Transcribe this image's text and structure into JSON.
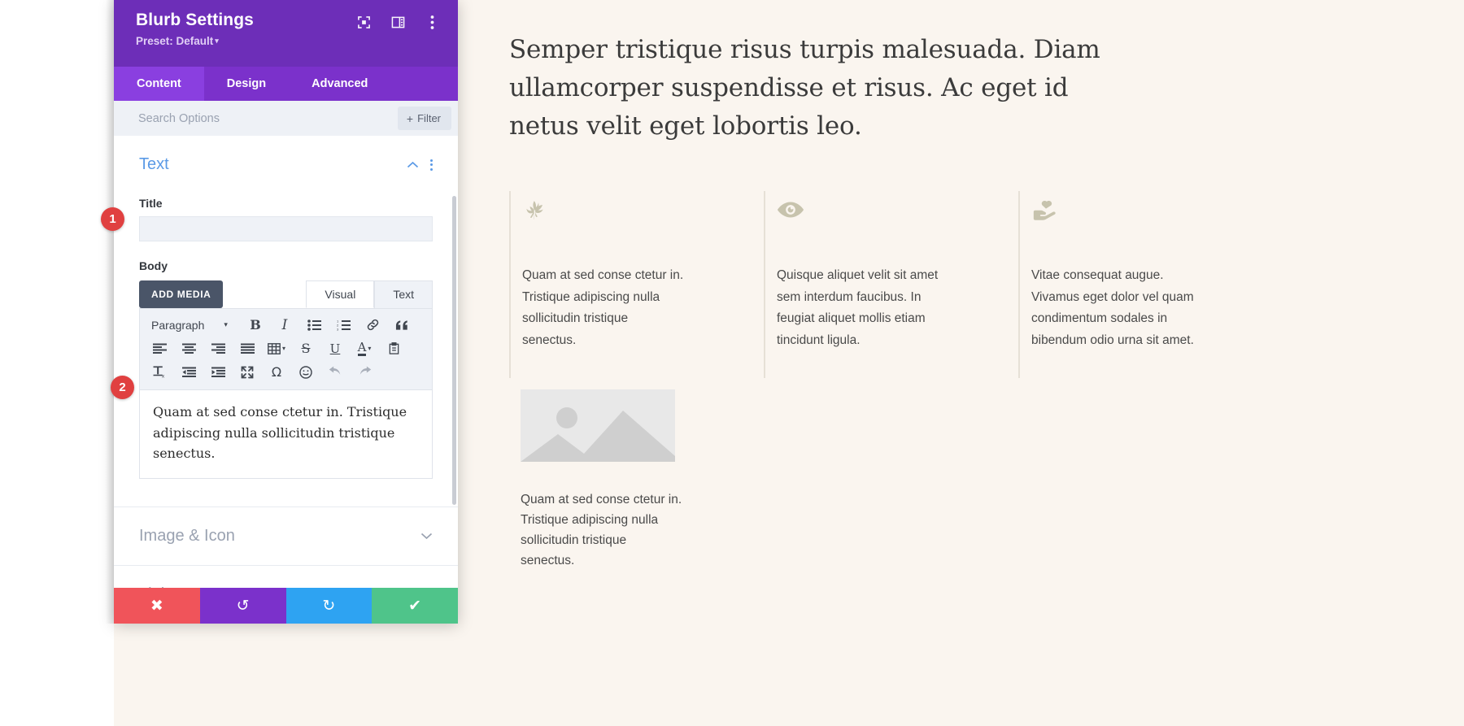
{
  "modal": {
    "title": "Blurb Settings",
    "preset_label": "Preset: Default",
    "preset_caret": "▾",
    "header_icons": [
      {
        "name": "focus-icon"
      },
      {
        "name": "layout-panel-icon"
      },
      {
        "name": "kebab-menu-icon"
      }
    ],
    "tabs": [
      {
        "label": "Content",
        "active": true
      },
      {
        "label": "Design",
        "active": false
      },
      {
        "label": "Advanced",
        "active": false
      }
    ],
    "search": {
      "placeholder": "Search Options",
      "value": ""
    },
    "filter": {
      "label": "Filter",
      "plus": "+"
    }
  },
  "sections": {
    "text": {
      "title": "Text",
      "title_field": {
        "label": "Title",
        "value": "",
        "placeholder": ""
      },
      "body_field": {
        "label": "Body",
        "add_media_label": "ADD MEDIA",
        "editor_tabs": [
          {
            "label": "Visual",
            "active": true
          },
          {
            "label": "Text",
            "active": false
          }
        ],
        "format_select": {
          "value": "Paragraph",
          "caret": "▾"
        },
        "toolbar_rows": [
          [
            {
              "name": "bold-icon",
              "glyph": "B"
            },
            {
              "name": "italic-icon",
              "glyph": "I"
            },
            {
              "name": "bulleted-list-icon",
              "glyph": ""
            },
            {
              "name": "numbered-list-icon",
              "glyph": ""
            },
            {
              "name": "link-icon",
              "glyph": ""
            },
            {
              "name": "blockquote-icon",
              "glyph": ""
            }
          ],
          [
            {
              "name": "align-left-icon",
              "glyph": ""
            },
            {
              "name": "align-center-icon",
              "glyph": ""
            },
            {
              "name": "align-right-icon",
              "glyph": ""
            },
            {
              "name": "align-justify-icon",
              "glyph": ""
            },
            {
              "name": "table-icon",
              "glyph": ""
            },
            {
              "name": "strikethrough-icon",
              "glyph": "S"
            },
            {
              "name": "underline-icon",
              "glyph": "U"
            },
            {
              "name": "text-color-icon",
              "glyph": "A"
            },
            {
              "name": "paste-as-text-icon",
              "glyph": ""
            }
          ],
          [
            {
              "name": "clear-formatting-icon",
              "glyph": "Tx"
            },
            {
              "name": "outdent-icon",
              "glyph": ""
            },
            {
              "name": "indent-icon",
              "glyph": ""
            },
            {
              "name": "fullscreen-icon",
              "glyph": ""
            },
            {
              "name": "special-character-icon",
              "glyph": "Ω"
            },
            {
              "name": "emoji-icon",
              "glyph": "☺"
            },
            {
              "name": "undo-icon",
              "glyph": "↶"
            },
            {
              "name": "redo-icon",
              "glyph": "↷"
            }
          ]
        ],
        "content": "Quam at sed conse ctetur in. Tristique adipiscing nulla sollicitudin tristique senectus."
      }
    },
    "image_icon": {
      "title": "Image & Icon"
    },
    "link": {
      "title": "Link"
    }
  },
  "action_bar": [
    {
      "name": "cancel-button",
      "glyph": "✖",
      "color": "#f0545a"
    },
    {
      "name": "undo-button",
      "glyph": "↺",
      "color": "#7b31cb"
    },
    {
      "name": "redo-button",
      "glyph": "↻",
      "color": "#2ea3f2"
    },
    {
      "name": "save-button",
      "glyph": "✔",
      "color": "#4fc48a"
    }
  ],
  "callouts": [
    {
      "number": "1"
    },
    {
      "number": "2"
    }
  ],
  "preview": {
    "headline": "Semper tristique risus turpis malesuada. Diam ullamcorper suspendisse et risus. Ac eget id netus velit eget lobortis leo.",
    "columns": [
      {
        "icon": "leaf-icon",
        "text": "Quam at sed conse ctetur in. Tristique adipiscing nulla sollicitudin tristique senectus."
      },
      {
        "icon": "eye-icon",
        "text": "Quisque aliquet velit sit amet sem interdum faucibus. In feugiat aliquet mollis etiam tincidunt ligula."
      },
      {
        "icon": "hand-heart-icon",
        "text": "Vitae consequat augue. Vivamus eget dolor vel quam condimentum sodales in bibendum odio urna sit amet."
      }
    ],
    "image_block": {
      "icon": "image-placeholder-icon",
      "caption": "Quam at sed conse ctetur in. Tristique adipiscing nulla sollicitudin tristique senectus."
    }
  },
  "colors": {
    "header_purple": "#6d2eb8",
    "tab_purple": "#7b31cb",
    "tab_active_purple": "#8a3fe0",
    "section_blue": "#5b9ae6",
    "canvas_cream": "#faf5ef",
    "icon_sage": "#c7c3ad",
    "callout_red": "#e04040"
  }
}
